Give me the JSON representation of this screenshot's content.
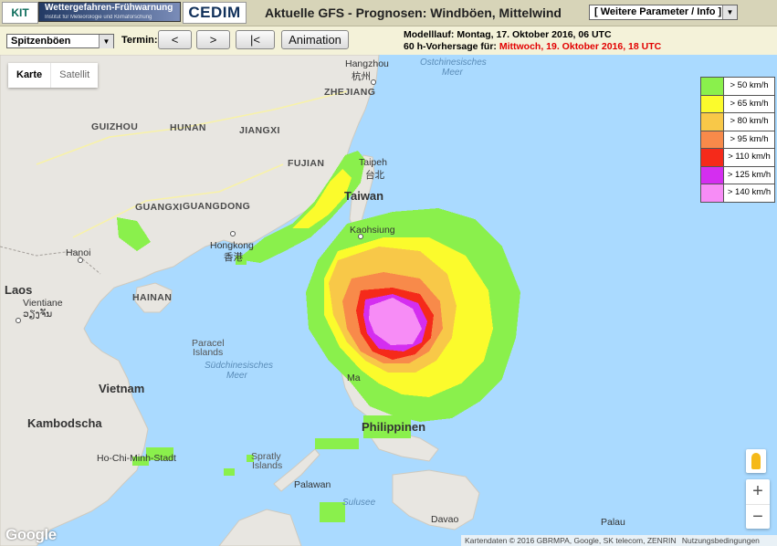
{
  "header": {
    "title": "Aktuelle GFS - Prognosen: Windböen, Mittelwind",
    "param_select": "[ Weitere Parameter / Info ]",
    "logo_kit": "KIT",
    "logo_fw_line1": "Wettergefahren-Frühwarnung",
    "logo_fw_line2": "Institut für Meteorologie und Klimaforschung",
    "logo_cedim": "CEDIM"
  },
  "controls": {
    "variable": "Spitzenböen",
    "termin_label": "Termin:",
    "prev": "<",
    "next": ">",
    "first": "|<",
    "animation": "Animation",
    "modelllauf": "Modelllauf: Montag, 17. Oktober 2016, 06 UTC",
    "forecast_prefix": "60 h-Vorhersage für:",
    "forecast_time": "Mittwoch, 19. Oktober 2016, 18 UTC"
  },
  "map": {
    "type_karte": "Karte",
    "type_satellit": "Satellit",
    "zoom_in": "+",
    "zoom_out": "−",
    "google": "Google",
    "attribution": "Kartendaten © 2016 GBRMPA, Google, SK telecom, ZENRIN",
    "terms": "Nutzungsbedingungen",
    "labels": {
      "hangzhou": "Hangzhou",
      "hangzhou_cn": "杭州",
      "zhejiang": "ZHEJIANG",
      "guizhou": "GUIZHOU",
      "hunan": "HUNAN",
      "jiangxi": "JIANGXI",
      "fujian": "FUJIAN",
      "taipei": "Taipeh",
      "taipei_cn": "台北",
      "taiwan": "Taiwan",
      "kaohsiung": "Kaohsiung",
      "guangdong": "GUANGDONG",
      "guangxi": "GUANGXI",
      "hongkong": "Hongkong",
      "hongkong_cn": "香港",
      "hanoi": "Hanoi",
      "laos": "Laos",
      "vientiane": "Vientiane",
      "vientiane_lo": "ວຽງຈັນ",
      "hainan": "HAINAN",
      "paracel1": "Paracel",
      "paracel2": "Islands",
      "sea1": "Südchinesisches",
      "sea2": "Meer",
      "vietnam": "Vietnam",
      "kambodscha": "Kambodscha",
      "hcmc": "Ho-Chi-Minh-Stadt",
      "spratly1": "Spratly",
      "spratly2": "Islands",
      "palawan": "Palawan",
      "sulu": "Sulusee",
      "philippinen": "Philippinen",
      "davao": "Davao",
      "palau": "Palau",
      "manila": "Ma",
      "ostsee1": "Ostchinesisches",
      "ostsee2": "Meer"
    }
  },
  "legend": [
    {
      "label": "> 50 km/h",
      "color": "#8af04c"
    },
    {
      "label": "> 65 km/h",
      "color": "#fbfb2c"
    },
    {
      "label": "> 80 km/h",
      "color": "#f8c848"
    },
    {
      "label": "> 95 km/h",
      "color": "#f88a4a"
    },
    {
      "label": "> 110 km/h",
      "color": "#f52a1a"
    },
    {
      "label": "> 125 km/h",
      "color": "#d42ef0"
    },
    {
      "label": "> 140 km/h",
      "color": "#f78cf6"
    }
  ]
}
